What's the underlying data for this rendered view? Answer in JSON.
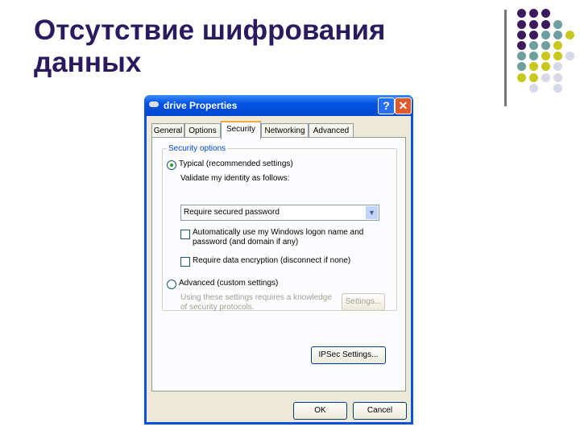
{
  "slide": {
    "title_line1": "Отсутствие шифрования",
    "title_line2": "данных"
  },
  "decor": {
    "colors": {
      "purple": "#3d1a5e",
      "teal": "#6e9e9e",
      "yellow": "#c8c81e",
      "lilac": "#d8d8e8"
    },
    "grid": [
      [
        "purple",
        "purple",
        "purple",
        null,
        null
      ],
      [
        "purple",
        "purple",
        "purple",
        "teal",
        null
      ],
      [
        "purple",
        "purple",
        "teal",
        "teal",
        "yellow"
      ],
      [
        "purple",
        "teal",
        "teal",
        "yellow",
        null
      ],
      [
        "teal",
        "teal",
        "yellow",
        "yellow",
        "lilac"
      ],
      [
        "teal",
        "yellow",
        "yellow",
        "lilac",
        null
      ],
      [
        "yellow",
        "yellow",
        "lilac",
        "lilac",
        null
      ],
      [
        null,
        "lilac",
        null,
        "lilac",
        null
      ]
    ]
  },
  "dialog": {
    "title": "drive Properties",
    "help": "?",
    "close": "✕",
    "tabs": [
      "General",
      "Options",
      "Security",
      "Networking",
      "Advanced"
    ],
    "active_tab": "Security",
    "group_label": "Security options",
    "typical_label": "Typical (recommended settings)",
    "typical_selected": true,
    "validate_label": "Validate my identity as follows:",
    "validate_value": "Require secured password",
    "auto_logon_label_1": "Automatically use my Windows logon name and",
    "auto_logon_label_2": "password (and domain if any)",
    "auto_logon_checked": false,
    "encryption_label": "Require data encryption (disconnect if none)",
    "encryption_checked": false,
    "advanced_label": "Advanced (custom settings)",
    "advanced_selected": false,
    "advanced_note_1": "Using these settings requires a knowledge",
    "advanced_note_2": "of security protocols.",
    "settings_button": "Settings...",
    "ipsec_button": "IPSec Settings...",
    "ok_button": "OK",
    "cancel_button": "Cancel"
  }
}
